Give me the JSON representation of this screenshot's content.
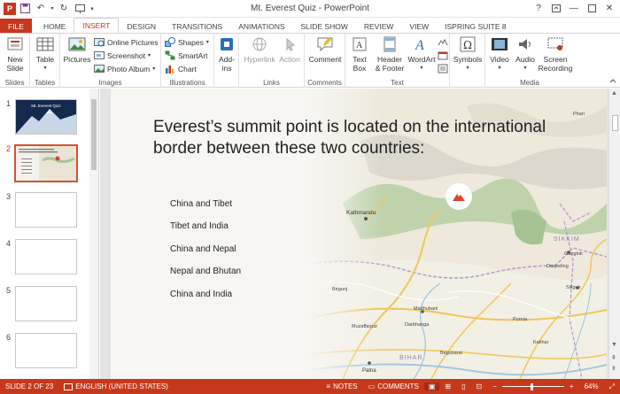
{
  "window": {
    "title": "Mt. Everest Quiz - PowerPoint"
  },
  "tabs": [
    "FILE",
    "HOME",
    "INSERT",
    "DESIGN",
    "TRANSITIONS",
    "ANIMATIONS",
    "SLIDE SHOW",
    "REVIEW",
    "VIEW",
    "ISPRING SUITE 8"
  ],
  "active_tab": "INSERT",
  "ribbon": {
    "slides": {
      "label": "Slides",
      "new_slide": "New",
      "new_slide2": "Slide"
    },
    "tables": {
      "label": "Tables",
      "table": "Table"
    },
    "images": {
      "label": "Images",
      "pictures": "Pictures",
      "online_pictures": "Online Pictures",
      "screenshot": "Screenshot",
      "photo_album": "Photo Album"
    },
    "illustrations": {
      "label": "Illustrations",
      "shapes": "Shapes",
      "smartart": "SmartArt",
      "chart": "Chart"
    },
    "addins": {
      "label": "",
      "addins": "Add-",
      "addins2": "ins"
    },
    "links": {
      "label": "Links",
      "hyperlink": "Hyperlink",
      "action": "Action"
    },
    "comments": {
      "label": "Comments",
      "comment": "Comment"
    },
    "text": {
      "label": "Text",
      "textbox": "Text",
      "textbox2": "Box",
      "header_footer": "Header",
      "header_footer2": "& Footer",
      "wordart": "WordArt"
    },
    "symbols": {
      "label": "",
      "symbols": "Symbols"
    },
    "media": {
      "label": "Media",
      "video": "Video",
      "audio": "Audio",
      "screen_recording": "Screen",
      "screen_recording2": "Recording"
    }
  },
  "thumbnails": [
    {
      "num": "1",
      "title": "Mt. Everest Quiz"
    },
    {
      "num": "2"
    },
    {
      "num": "3"
    },
    {
      "num": "4"
    },
    {
      "num": "5"
    },
    {
      "num": "6"
    }
  ],
  "slide": {
    "title": "Everest’s summit point is located on the international border between these two countries:",
    "answers": [
      "China and Tibet",
      "Tibet and India",
      "China and Nepal",
      "Nepal and Bhutan",
      "China and India"
    ]
  },
  "map": {
    "labels": {
      "kathmandu": "Kathmandu",
      "bihar": "BIHAR",
      "sikkim": "SIKKIM",
      "patna": "Patna",
      "madhubani": "Madhubani",
      "darbhanga": "Darbhanga",
      "gangtok": "Gangtok",
      "darjeeling": "Darjeeling",
      "siliguri": "Siliguri",
      "purnia": "Purnia",
      "muzaffarpur": "Muzaffarpur",
      "begusarai": "Begusarai",
      "birgunj": "Birgunj",
      "katihar": "Katihar",
      "phari": "Phari"
    }
  },
  "status": {
    "slide_info": "SLIDE 2 OF 23",
    "language": "ENGLISH (UNITED STATES)",
    "notes": "NOTES",
    "comments": "COMMENTS",
    "zoom": "64%"
  },
  "colors": {
    "accent": "#c6381c",
    "marker": "#e0432b"
  }
}
